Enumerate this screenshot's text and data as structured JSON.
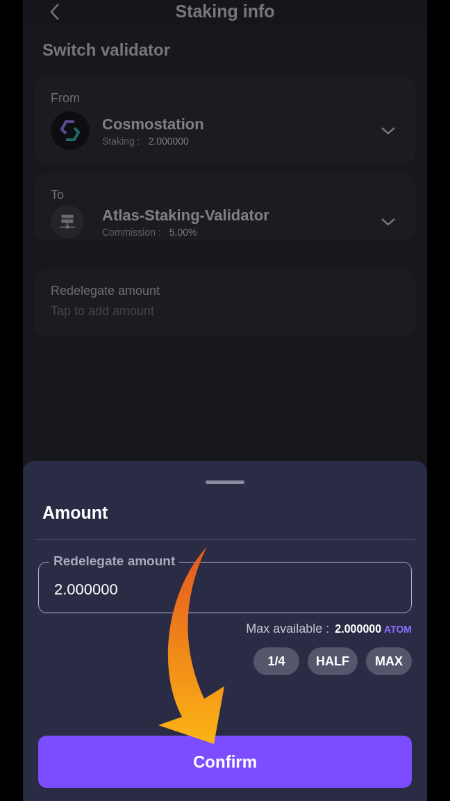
{
  "header": {
    "title": "Staking info"
  },
  "section_title": "Switch validator",
  "validators": [
    {
      "kind": "from",
      "label": "From",
      "name": "Cosmostation",
      "detail_label": "Staking :",
      "detail_value": "2.000000"
    },
    {
      "kind": "to",
      "label": "To",
      "name": "Atlas-Staking-Validator",
      "detail_label": "Commission :",
      "detail_value": "5.00%"
    }
  ],
  "redelegate": {
    "label": "Redelegate amount",
    "hint": "Tap to add amount"
  },
  "sheet": {
    "title": "Amount",
    "field": {
      "label": "Redelegate amount",
      "value": "2.000000"
    },
    "max_label": "Max available :",
    "max_value": "2.000000",
    "max_unit": "ATOM",
    "quick_buttons": [
      "1/4",
      "HALF",
      "MAX"
    ],
    "confirm": "Confirm"
  }
}
